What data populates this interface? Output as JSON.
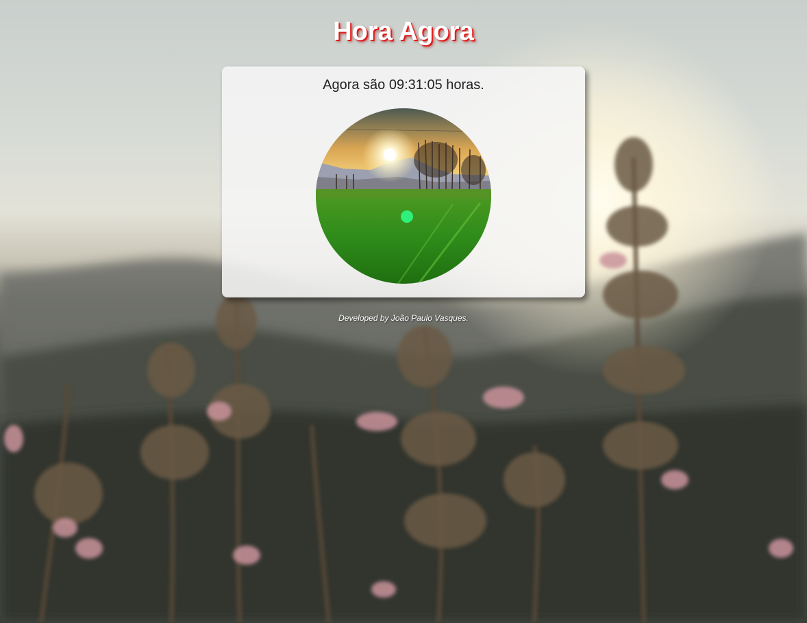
{
  "header": {
    "title": "Hora Agora"
  },
  "clock": {
    "message": "Agora são 09:31:05 horas.",
    "image_icon": "morning-landscape-image"
  },
  "footer": {
    "credit": "Developed by João Paulo Vasques."
  },
  "colors": {
    "title_text": "#ffffff",
    "title_shadow": "#e01c1c",
    "card_bg": "#f5f5f5",
    "field_green": "#2f9a1e",
    "sky_gold": "#e8b65a"
  }
}
